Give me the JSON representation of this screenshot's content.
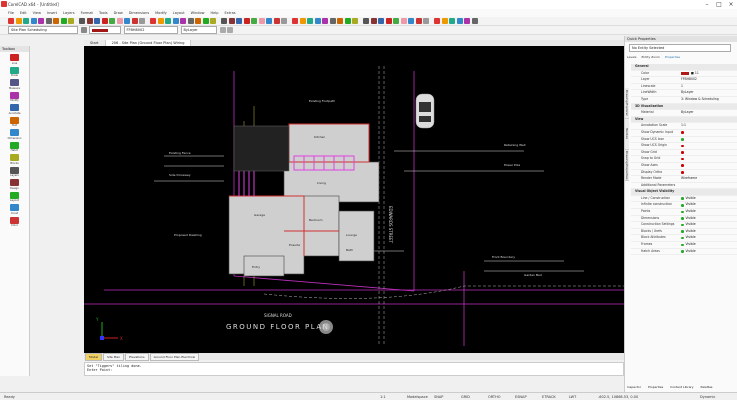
{
  "window": {
    "title": "CorelCAD x64 - [Untitled]"
  },
  "menu": [
    "File",
    "Edit",
    "View",
    "Insert",
    "Layers",
    "Format",
    "Tools",
    "Draw",
    "Dimensions",
    "Modify",
    "Layout",
    "Window",
    "Help",
    "Extras"
  ],
  "toolbar": {
    "style_combo": "Site Plan Scheduling",
    "layer_combo": "FFBH8002",
    "color_swatch": "#a01818",
    "linetype_combo": "ByLayer"
  },
  "doc_tabs": [
    {
      "label": "Start",
      "active": false
    },
    {
      "label": "206 - Site Plan (Ground Floor Plan) Wiring",
      "active": true
    }
  ],
  "toolbox": {
    "header": "Toolbox",
    "tools": [
      {
        "label": "Line",
        "color": "#c22"
      },
      {
        "label": "Draw",
        "color": "#2a8"
      },
      {
        "label": "Measure",
        "color": "#558"
      },
      {
        "label": "Modify",
        "color": "#a3a"
      },
      {
        "label": "Annotate",
        "color": "#36a"
      },
      {
        "label": "Text",
        "color": "#c60"
      },
      {
        "label": "Dimension",
        "color": "#38c"
      },
      {
        "label": "Hatch",
        "color": "#2a2"
      },
      {
        "label": "Blocks",
        "color": "#aa2"
      },
      {
        "label": "Layers",
        "color": "#555"
      },
      {
        "label": "Design",
        "color": "#833"
      },
      {
        "label": "Layout",
        "color": "#2a2"
      },
      {
        "label": "Cloud",
        "color": "#38c"
      },
      {
        "label": "Color",
        "color": "#c33"
      }
    ]
  },
  "drawing": {
    "title": "GROUND FLOOR PLAN",
    "street_label": "EDWARDS STREET",
    "road_label": "SIGNAL ROAD",
    "rooms": [
      "Kitchen",
      "Living",
      "Garage",
      "Bedroom",
      "Lounge",
      "Ensuite",
      "Bath",
      "Entry"
    ],
    "notes": [
      "Existing Footpath",
      "Existing Fence",
      "Side Driveway",
      "Proposed Dwelling",
      "Front Boundary",
      "Retaining Wall",
      "Power Pole",
      "Garden Bed"
    ],
    "axis_y": "Y",
    "axis_x": "X"
  },
  "sheet_tabs": [
    {
      "label": "Model",
      "active": true
    },
    {
      "label": "Site Plan",
      "active": false
    },
    {
      "label": "Elevations",
      "active": false
    },
    {
      "label": "Ground Floor Plan Electrical",
      "active": false
    }
  ],
  "command_line": {
    "line1": "Set \"Tiggers\" tiling done.",
    "line2": "Enter Point:"
  },
  "status": {
    "left": "Ready",
    "items": [
      "1:1",
      "Modelspace",
      "SNAP",
      "GRID",
      "ORTHO",
      "ESNAP",
      "ETRACK",
      "LWT"
    ],
    "coords": "-602.5, 10868.53, 0.00",
    "right": "Dynamic"
  },
  "right_panel": {
    "tabs_header": "Quick Properties",
    "dropdown": "No Entity Selected",
    "subtabs": [
      "Levels",
      "Entity Zoom",
      "Properties"
    ],
    "vtabs": [
      "Drawing Explorer",
      "Toolbox",
      "Drawing Properties"
    ],
    "sections": [
      {
        "title": "General",
        "rows": [
          {
            "k": "Color",
            "v": "■ 11",
            "swatch": "#b01818"
          },
          {
            "k": "Layer",
            "v": "FFBH8002"
          },
          {
            "k": "Linescale",
            "v": "1"
          },
          {
            "k": "LineWidth",
            "v": "ByLayer"
          },
          {
            "k": "Type",
            "v": "3: Window & Scheduling"
          }
        ]
      },
      {
        "title": "3D Visualization",
        "rows": [
          {
            "k": "Material",
            "v": "ByLayer"
          }
        ]
      },
      {
        "title": "View",
        "rows": [
          {
            "k": "Annotation Scale",
            "v": "1:1"
          },
          {
            "k": "Show Dynamic Input",
            "v": "",
            "dot": "#c00"
          },
          {
            "k": "Show UCS Icon",
            "v": "",
            "dot": "#2a2"
          },
          {
            "k": "Show UCS Origin",
            "v": "",
            "dot": "#c00"
          },
          {
            "k": "Show Grid",
            "v": "",
            "dot": "#c00"
          },
          {
            "k": "Snap to Grid",
            "v": "",
            "dot": "#c00"
          },
          {
            "k": "Show Axes",
            "v": "",
            "dot": "#c00"
          },
          {
            "k": "Display Ortho",
            "v": "",
            "dot": "#c00"
          },
          {
            "k": "Render Mode",
            "v": "Wireframe"
          },
          {
            "k": "Additional Parameters",
            "v": ""
          }
        ]
      },
      {
        "title": "Visual Object Visibility",
        "rows": [
          {
            "k": "Line / Construction",
            "v": "Visible",
            "dot": "#2a2"
          },
          {
            "k": "Infinite construction",
            "v": "Visible",
            "dot": "#2a2"
          },
          {
            "k": "Points",
            "v": "Visible",
            "dot": "#2a2"
          },
          {
            "k": "Dimensions",
            "v": "Visible",
            "dot": "#2a2"
          },
          {
            "k": "Construction Settings",
            "v": "Visible",
            "dot": "#2a2"
          },
          {
            "k": "Blocks / Xrefs",
            "v": "Visible",
            "dot": "#2a2"
          },
          {
            "k": "Block Attributes",
            "v": "Visible",
            "dot": "#2a2"
          },
          {
            "k": "Frames",
            "v": "Visible",
            "dot": "#2a2"
          },
          {
            "k": "Hatch Areas",
            "v": "Visible",
            "dot": "#2a2"
          }
        ]
      }
    ],
    "bottom_tabs": [
      "Inspector",
      "Properties",
      "Content Library",
      "Palettes"
    ]
  }
}
